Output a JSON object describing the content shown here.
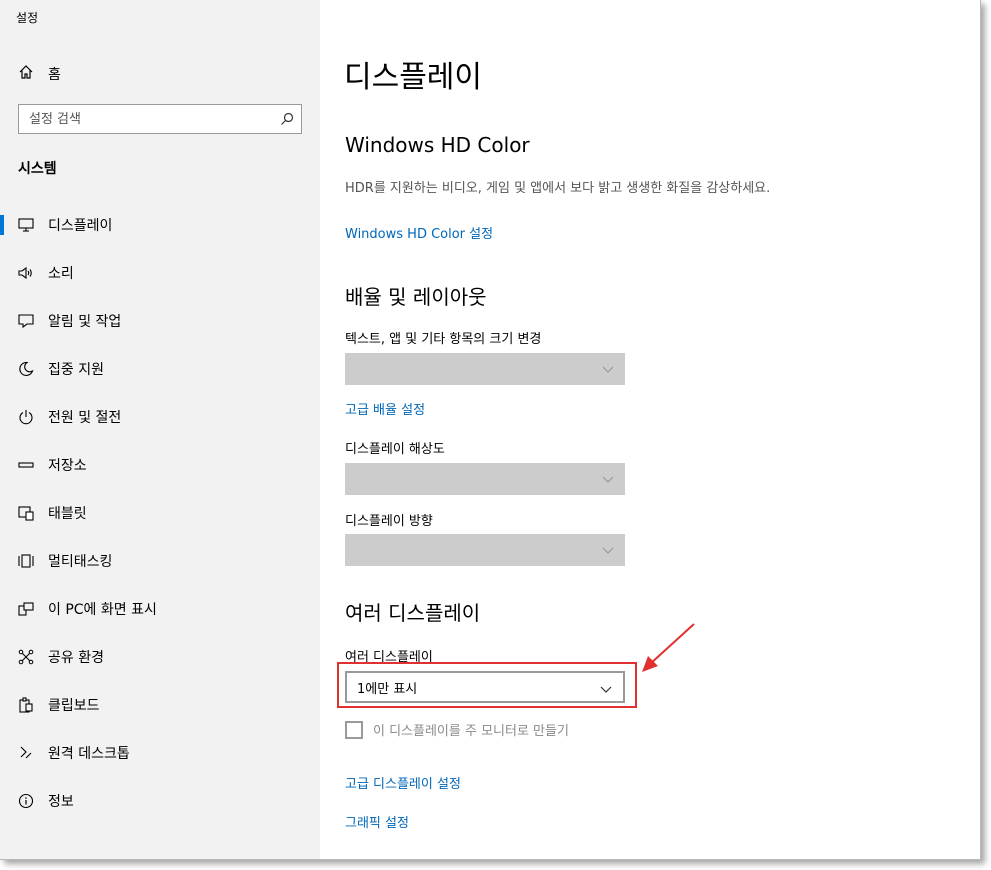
{
  "window": {
    "title": "설정"
  },
  "sidebar": {
    "home_label": "홈",
    "search_placeholder": "설정 검색",
    "section_title": "시스템",
    "items": [
      {
        "label": "디스플레이",
        "icon": "monitor-icon",
        "active": true
      },
      {
        "label": "소리",
        "icon": "speaker-icon"
      },
      {
        "label": "알림 및 작업",
        "icon": "notification-icon"
      },
      {
        "label": "집중 지원",
        "icon": "moon-icon"
      },
      {
        "label": "전원 및 절전",
        "icon": "power-icon"
      },
      {
        "label": "저장소",
        "icon": "storage-icon"
      },
      {
        "label": "태블릿",
        "icon": "tablet-icon"
      },
      {
        "label": "멀티태스킹",
        "icon": "multitasking-icon"
      },
      {
        "label": "이 PC에 화면 표시",
        "icon": "project-icon"
      },
      {
        "label": "공유 환경",
        "icon": "shared-experiences-icon"
      },
      {
        "label": "클립보드",
        "icon": "clipboard-icon"
      },
      {
        "label": "원격 데스크톱",
        "icon": "remote-desktop-icon"
      },
      {
        "label": "정보",
        "icon": "info-icon"
      }
    ]
  },
  "main": {
    "title": "디스플레이",
    "hdr": {
      "heading": "Windows HD Color",
      "description": "HDR를 지원하는 비디오, 게임 및 앱에서 보다 밝고 생생한 화질을 감상하세요.",
      "link": "Windows HD Color 설정"
    },
    "scale": {
      "heading": "배율 및 레이아웃",
      "text_size_label": "텍스트, 앱 및 기타 항목의 크기 변경",
      "advanced_link": "고급 배율 설정",
      "resolution_label": "디스플레이 해상도",
      "orientation_label": "디스플레이 방향"
    },
    "multi": {
      "heading": "여러 디스플레이",
      "dropdown_label": "여러 디스플레이",
      "dropdown_value": "1에만 표시",
      "checkbox_label": "이 디스플레이를 주 모니터로 만들기",
      "advanced_link": "고급 디스플레이 설정",
      "graphics_link": "그래픽 설정"
    }
  },
  "colors": {
    "accent": "#0078d7",
    "link": "#0067b8",
    "annotation": "#e03030"
  }
}
